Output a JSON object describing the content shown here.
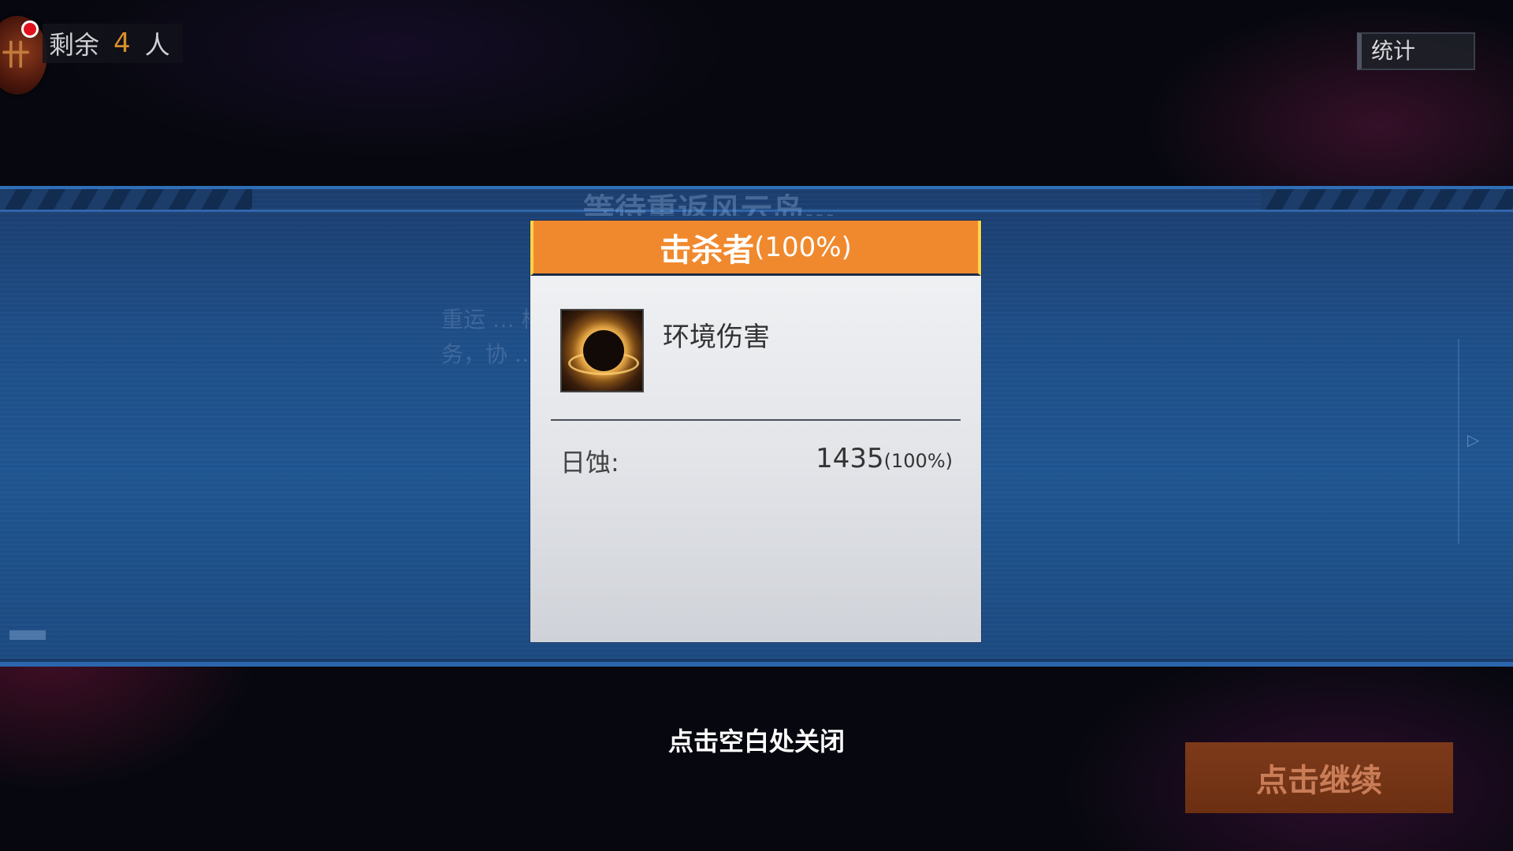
{
  "hud": {
    "remain_prefix": "剩余",
    "remain_count": "4",
    "remain_suffix": "人",
    "stats_label": "统计"
  },
  "background": {
    "title": "等待重返风云岛…",
    "desc_line1": "重运 … 样本的任",
    "desc_line2": "务，协 … 奖励。"
  },
  "modal": {
    "title": "击杀者",
    "title_percent": "(100%)",
    "killer_name": "环境伤害",
    "skill_label": "日蚀:",
    "skill_damage": "1435",
    "skill_percent": "(100%)"
  },
  "footer": {
    "close_hint": "点击空白处关闭",
    "continue_label": "点击继续"
  },
  "colors": {
    "header_orange": "#f0892e",
    "band_blue": "#1f5590",
    "remain_count": "#d6902d",
    "continue_button": "#7d3a1a"
  }
}
